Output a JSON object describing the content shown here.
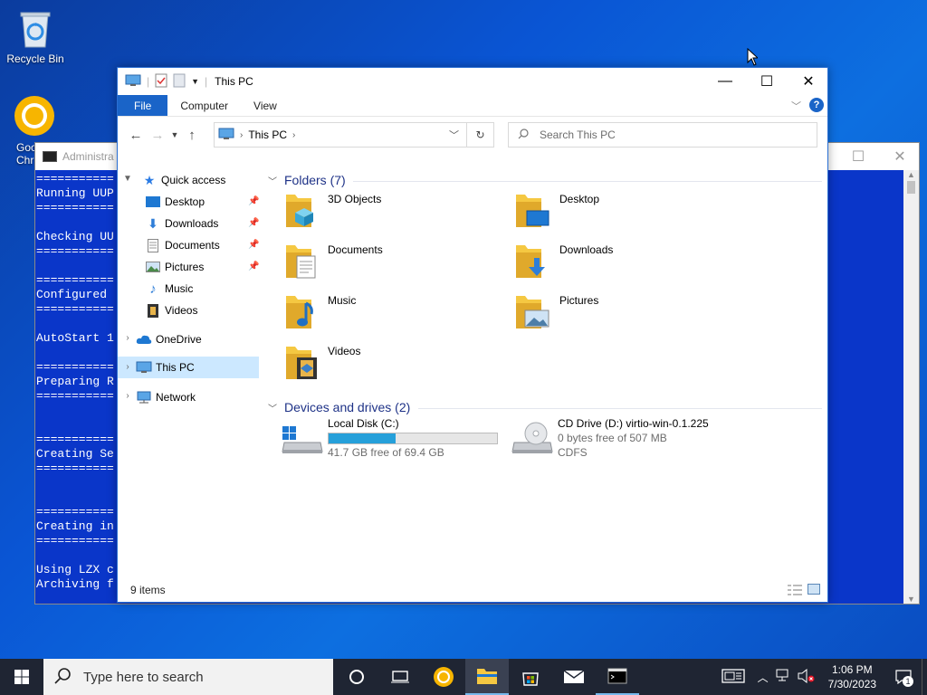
{
  "desktop": {
    "icons": [
      {
        "label": "Recycle Bin",
        "icon": "recycle-bin-icon"
      },
      {
        "label": "Goo\nChr",
        "icon": "chrome-icon"
      }
    ]
  },
  "console": {
    "title": "Administra",
    "lines": [
      "===========",
      "Running UUP",
      "===========",
      "",
      "Checking UU",
      "===========",
      "",
      "===========",
      "Configured ",
      "===========",
      "",
      "AutoStart 1",
      "",
      "===========",
      "Preparing R",
      "===========",
      "",
      "",
      "===========",
      "Creating Se",
      "===========",
      "",
      "",
      "===========",
      "Creating in",
      "===========",
      "",
      "Using LZX c",
      "Archiving f"
    ]
  },
  "explorer": {
    "title": "This PC",
    "ribbon_tabs": [
      "File",
      "Computer",
      "View"
    ],
    "address": {
      "location": "This PC"
    },
    "search": {
      "placeholder": "Search This PC"
    },
    "nav": {
      "quick_access": "Quick access",
      "pinned": [
        "Desktop",
        "Downloads",
        "Documents",
        "Pictures"
      ],
      "unpinned": [
        "Music",
        "Videos"
      ],
      "onedrive": "OneDrive",
      "this_pc": "This PC",
      "network": "Network"
    },
    "folders_header": "Folders (7)",
    "folders": [
      "3D Objects",
      "Desktop",
      "Documents",
      "Downloads",
      "Music",
      "Pictures",
      "Videos"
    ],
    "devices_header": "Devices and drives (2)",
    "drives": [
      {
        "name": "Local Disk (C:)",
        "free": "41.7 GB free of 69.4 GB",
        "used_fraction": 0.4
      },
      {
        "name": "CD Drive (D:) virtio-win-0.1.225",
        "free": "0 bytes free of 507 MB",
        "fs": "CDFS"
      }
    ],
    "status": "9 items"
  },
  "taskbar": {
    "search_placeholder": "Type here to search",
    "time": "1:06 PM",
    "date": "7/30/2023",
    "notification_count": "1"
  },
  "colors": {
    "accent": "#1a64c8",
    "selection": "#cce8ff",
    "console_bg": "#0a36c9",
    "taskbar": "#1f2533",
    "drive_fill": "#26a0da"
  }
}
